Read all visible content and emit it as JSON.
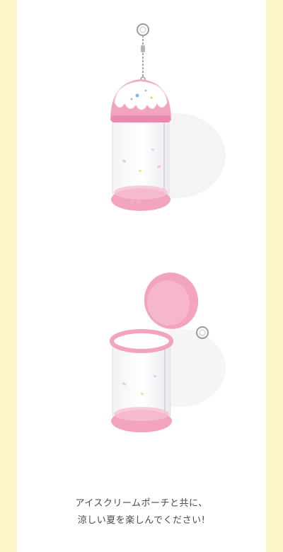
{
  "caption": {
    "line1": "アイスクリームポーチと共に、",
    "line2": "涼しい夏を楽しんでください!"
  },
  "products": [
    {
      "id": "closed",
      "name": "ice cream pouch closed with keyring"
    },
    {
      "id": "open",
      "name": "ice cream pouch open with lid"
    }
  ],
  "colors": {
    "background": "#fbf5c9",
    "panel": "#ffffff",
    "pink": "#f2a3bf",
    "pink_dark": "#e88aae",
    "cream": "#ffffff",
    "text": "#4a4a4a"
  }
}
